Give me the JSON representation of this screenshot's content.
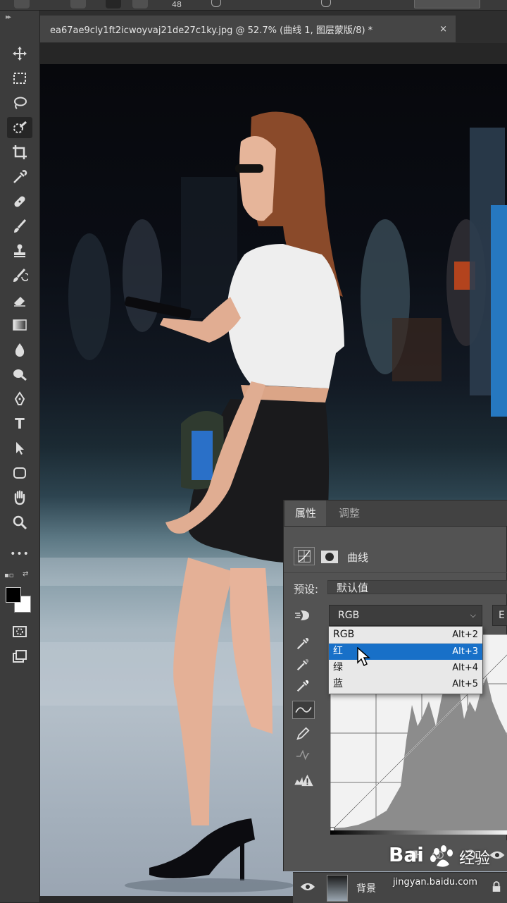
{
  "options_bar": {
    "brush_size": "48"
  },
  "document_tab": {
    "title": "ea67ae9cly1ft2icwoyvaj21de27c1ky.jpg @ 52.7% (曲线 1, 图层蒙版/8) *",
    "close": "×"
  },
  "toolbar": {
    "tools": [
      "move-icon",
      "marquee-icon",
      "lasso-icon",
      "quick-select-icon",
      "crop-icon",
      "eyedropper-icon",
      "healing-icon",
      "brush-icon",
      "stamp-icon",
      "history-brush-icon",
      "eraser-icon",
      "gradient-icon",
      "blur-icon",
      "dodge-icon",
      "pen-icon",
      "type-icon",
      "path-select-icon",
      "shape-icon",
      "hand-icon",
      "zoom-icon",
      "more-icon"
    ],
    "type_tool_glyph": "T",
    "more_glyph": "•••",
    "foreground_color": "#000000",
    "background_color": "#ffffff"
  },
  "properties_panel": {
    "tabs": [
      {
        "label": "属性",
        "active": true
      },
      {
        "label": "调整",
        "active": false
      }
    ],
    "adjustment_title": "曲线",
    "preset_label": "预设:",
    "preset_value": "默认值",
    "channel_value": "RGB",
    "auto_button": "E"
  },
  "channel_menu": {
    "items": [
      {
        "label": "RGB",
        "shortcut": "Alt+2",
        "selected": false
      },
      {
        "label": "红",
        "shortcut": "Alt+3",
        "selected": true
      },
      {
        "label": "绿",
        "shortcut": "Alt+4",
        "selected": false
      },
      {
        "label": "蓝",
        "shortcut": "Alt+5",
        "selected": false
      }
    ]
  },
  "layers": {
    "name": "背景"
  },
  "watermark": {
    "brand": "Bai",
    "brand_cn": "经验",
    "url": "jingyan.baidu.com"
  },
  "colors": {
    "accent_selection": "#1870c8",
    "panel": "#535353",
    "toolbar": "#3c3c3c"
  }
}
